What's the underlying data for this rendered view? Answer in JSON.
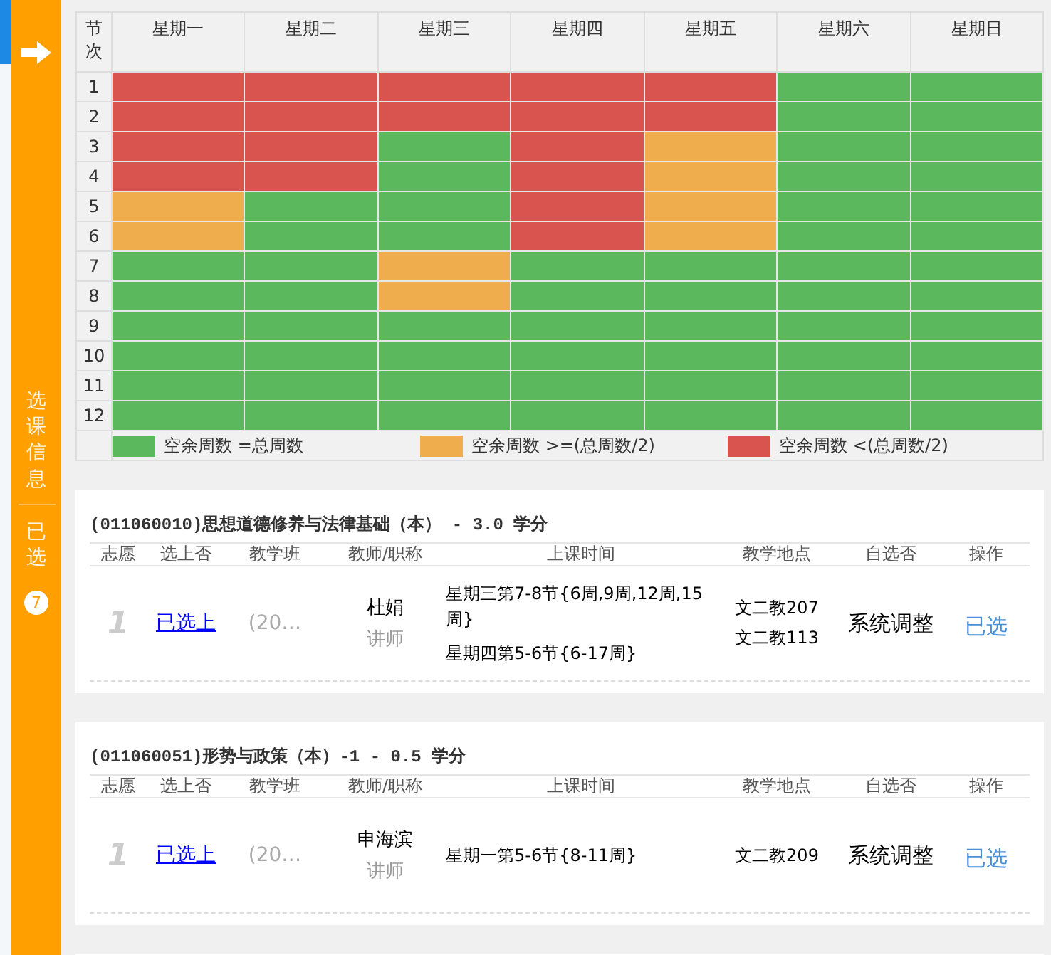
{
  "sidebar": {
    "title": "选课信息",
    "section": "已选",
    "badge": "7"
  },
  "timetable": {
    "corner": "节次",
    "days": [
      "星期一",
      "星期二",
      "星期三",
      "星期四",
      "星期五",
      "星期六",
      "星期日"
    ],
    "rows": [
      {
        "period": "1",
        "cells": [
          {
            "color": "#d9534f"
          },
          {
            "color": "#d9534f"
          },
          {
            "color": "#d9534f"
          },
          {
            "color": "#d9534f"
          },
          {
            "color": "#d9534f"
          },
          {
            "color": "#5cb85c"
          },
          {
            "color": "#5cb85c"
          }
        ]
      },
      {
        "period": "2",
        "cells": [
          {
            "color": "#d9534f"
          },
          {
            "color": "#d9534f"
          },
          {
            "color": "#d9534f"
          },
          {
            "color": "#d9534f"
          },
          {
            "color": "#d9534f"
          },
          {
            "color": "#5cb85c"
          },
          {
            "color": "#5cb85c"
          }
        ]
      },
      {
        "period": "3",
        "cells": [
          {
            "color": "#d9534f"
          },
          {
            "color": "#d9534f"
          },
          {
            "color": "#5cb85c"
          },
          {
            "color": "#d9534f"
          },
          {
            "color": "#f0ad4e"
          },
          {
            "color": "#5cb85c"
          },
          {
            "color": "#5cb85c"
          }
        ]
      },
      {
        "period": "4",
        "cells": [
          {
            "color": "#d9534f"
          },
          {
            "color": "#d9534f"
          },
          {
            "color": "#5cb85c"
          },
          {
            "color": "#d9534f"
          },
          {
            "color": "#f0ad4e"
          },
          {
            "color": "#5cb85c"
          },
          {
            "color": "#5cb85c"
          }
        ]
      },
      {
        "period": "5",
        "cells": [
          {
            "color": "#f0ad4e"
          },
          {
            "color": "#5cb85c"
          },
          {
            "color": "#5cb85c"
          },
          {
            "color": "#d9534f"
          },
          {
            "color": "#f0ad4e"
          },
          {
            "color": "#5cb85c"
          },
          {
            "color": "#5cb85c"
          }
        ]
      },
      {
        "period": "6",
        "cells": [
          {
            "color": "#f0ad4e"
          },
          {
            "color": "#5cb85c"
          },
          {
            "color": "#5cb85c"
          },
          {
            "color": "#d9534f"
          },
          {
            "color": "#f0ad4e"
          },
          {
            "color": "#5cb85c"
          },
          {
            "color": "#5cb85c"
          }
        ]
      },
      {
        "period": "7",
        "cells": [
          {
            "color": "#5cb85c"
          },
          {
            "color": "#5cb85c"
          },
          {
            "color": "#f0ad4e"
          },
          {
            "color": "#5cb85c"
          },
          {
            "color": "#5cb85c"
          },
          {
            "color": "#5cb85c"
          },
          {
            "color": "#5cb85c"
          }
        ]
      },
      {
        "period": "8",
        "cells": [
          {
            "color": "#5cb85c"
          },
          {
            "color": "#5cb85c"
          },
          {
            "color": "#f0ad4e"
          },
          {
            "color": "#5cb85c"
          },
          {
            "color": "#5cb85c"
          },
          {
            "color": "#5cb85c"
          },
          {
            "color": "#5cb85c"
          }
        ]
      },
      {
        "period": "9",
        "cells": [
          {
            "color": "#5cb85c"
          },
          {
            "color": "#5cb85c"
          },
          {
            "color": "#5cb85c"
          },
          {
            "color": "#5cb85c"
          },
          {
            "color": "#5cb85c"
          },
          {
            "color": "#5cb85c"
          },
          {
            "color": "#5cb85c"
          }
        ]
      },
      {
        "period": "10",
        "cells": [
          {
            "color": "#5cb85c"
          },
          {
            "color": "#5cb85c"
          },
          {
            "color": "#5cb85c"
          },
          {
            "color": "#5cb85c"
          },
          {
            "color": "#5cb85c"
          },
          {
            "color": "#5cb85c"
          },
          {
            "color": "#5cb85c"
          }
        ]
      },
      {
        "period": "11",
        "cells": [
          {
            "color": "#5cb85c"
          },
          {
            "color": "#5cb85c"
          },
          {
            "color": "#5cb85c"
          },
          {
            "color": "#5cb85c"
          },
          {
            "color": "#5cb85c"
          },
          {
            "color": "#5cb85c"
          },
          {
            "color": "#5cb85c"
          }
        ]
      },
      {
        "period": "12",
        "cells": [
          {
            "color": "#5cb85c"
          },
          {
            "color": "#5cb85c"
          },
          {
            "color": "#5cb85c"
          },
          {
            "color": "#5cb85c"
          },
          {
            "color": "#5cb85c"
          },
          {
            "color": "#5cb85c"
          },
          {
            "color": "#5cb85c"
          }
        ]
      }
    ],
    "legend": [
      {
        "label": "空余周数 =总周数",
        "color": "#5cb85c"
      },
      {
        "label": "空余周数 >=(总周数/2)",
        "color": "#f0ad4e"
      },
      {
        "label": "空余周数 <(总周数/2)",
        "color": "#d9534f"
      }
    ]
  },
  "courses": [
    {
      "title": "(011060010)思想道德修养与法律基础（本） - 3.0 学分",
      "columns": [
        "志愿",
        "选上否",
        "教学班",
        "教师/职称",
        "上课时间",
        "教学地点",
        "自选否",
        "操作"
      ],
      "row": {
        "wish": "1",
        "status": "已选上",
        "class": "(20…",
        "teacher": "杜娟",
        "rank": "讲师",
        "times": [
          "星期三第7-8节{6周,9周,12周,15周}",
          "星期四第5-6节{6-17周}"
        ],
        "places": [
          "文二教207",
          "文二教113"
        ],
        "mode": "系统调整",
        "action": "已选"
      }
    },
    {
      "title": "(011060051)形势与政策（本）-1 - 0.5 学分",
      "columns": [
        "志愿",
        "选上否",
        "教学班",
        "教师/职称",
        "上课时间",
        "教学地点",
        "自选否",
        "操作"
      ],
      "row": {
        "wish": "1",
        "status": "已选上",
        "class": "(20…",
        "teacher": "申海滨",
        "rank": "讲师",
        "times": [
          "星期一第5-6节{8-11周}"
        ],
        "places": [
          "文二教209"
        ],
        "mode": "系统调整",
        "action": "已选"
      }
    }
  ]
}
